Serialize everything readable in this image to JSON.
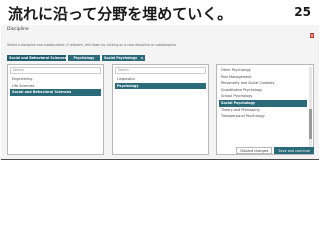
{
  "slide": {
    "title": "流れに沿って分野を埋めていく。",
    "number": "25"
  },
  "dialog": {
    "title": "Discipline",
    "instruction": "Select a discipline and subdiscipline. If relevant, drill down by clicking on a new discipline or subdiscipline.",
    "close_icon": "close-icon",
    "chips": [
      "Social and Behavioral Sciences",
      "Psychology",
      "Social Psychology"
    ],
    "chip_remove": "x",
    "columns": [
      {
        "search_placeholder": "Search",
        "items": [
          {
            "label": "Engineering",
            "selected": false
          },
          {
            "label": "Life Sciences",
            "selected": false
          },
          {
            "label": "Social and Behavioral Sciences",
            "selected": true
          }
        ]
      },
      {
        "search_placeholder": "Search",
        "items": [
          {
            "label": "Linguistics",
            "selected": false
          },
          {
            "label": "Psychology",
            "selected": true
          }
        ]
      },
      {
        "items": [
          {
            "label": "Other Psychology",
            "selected": false
          },
          {
            "label": "Pain Management",
            "selected": false
          },
          {
            "label": "Personality and Social Contexts",
            "selected": false
          },
          {
            "label": "Quantitative Psychology",
            "selected": false
          },
          {
            "label": "School Psychology",
            "selected": false
          },
          {
            "label": "Social Psychology",
            "selected": true
          },
          {
            "label": "Theory and Philosophy",
            "selected": false
          },
          {
            "label": "Transpersonal Psychology",
            "selected": false
          }
        ]
      }
    ],
    "buttons": {
      "discard": "Discard changes",
      "save": "Save and continue"
    },
    "colors": {
      "accent": "#2b6a78",
      "accent_dark": "#1f5f6d"
    }
  }
}
